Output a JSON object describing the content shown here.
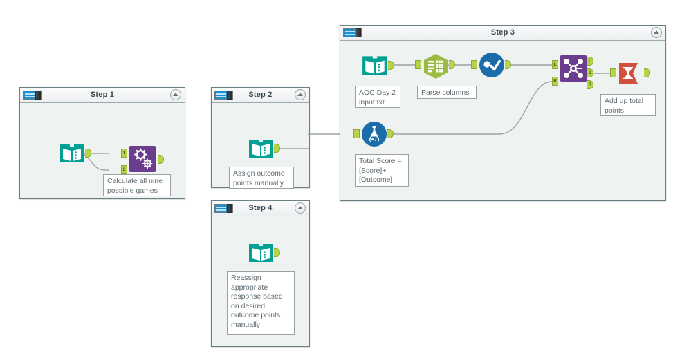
{
  "app": {
    "title": "Alteryx Designer workflow canvas",
    "canvas_background": "#ffffff",
    "container_fill": "#eef3f2",
    "container_border": "#6b7f86",
    "wire_color": "#9aa3a6",
    "anchor_color": "#b5d44a"
  },
  "containers": [
    {
      "id": "step1",
      "title": "Step 1",
      "toggle_icon": "container-toggle-icon",
      "collapse_icon": "chevron-up-icon"
    },
    {
      "id": "step2",
      "title": "Step 2",
      "toggle_icon": "container-toggle-icon",
      "collapse_icon": "chevron-up-icon"
    },
    {
      "id": "step3",
      "title": "Step 3",
      "toggle_icon": "container-toggle-icon",
      "collapse_icon": "chevron-up-icon"
    },
    {
      "id": "step4",
      "title": "Step 4",
      "toggle_icon": "container-toggle-icon",
      "collapse_icon": "chevron-up-icon"
    }
  ],
  "tools": {
    "step1_text_input": {
      "icon": "text-input-tool-icon",
      "color": "#00a094"
    },
    "step1_append_fields": {
      "icon": "append-fields-tool-icon",
      "color": "#6a3d8f",
      "input_t": "T",
      "input_s": "S"
    },
    "step2_text_input": {
      "icon": "text-input-tool-icon",
      "color": "#00a094"
    },
    "step3_input_data": {
      "icon": "input-data-tool-icon",
      "color": "#00a094"
    },
    "step3_text_to_columns": {
      "icon": "text-to-columns-tool-icon",
      "color": "#9bbb45"
    },
    "step3_select": {
      "icon": "select-tool-icon",
      "color": "#1b6ca8"
    },
    "step3_formula": {
      "icon": "formula-tool-icon",
      "color": "#1b6ca8"
    },
    "step3_join": {
      "icon": "join-tool-icon",
      "color": "#6a3d8f",
      "input_l": "L",
      "input_r": "R",
      "output_l": "L",
      "output_j": "J",
      "output_r": "R"
    },
    "step3_summarize": {
      "icon": "summarize-tool-icon",
      "color": "#d0503c"
    },
    "step4_text_input": {
      "icon": "text-input-tool-icon",
      "color": "#00a094"
    }
  },
  "annotations": {
    "step1_append": "Calculate all nine\npossible games",
    "step2_text_input": "Assign outcome\npoints manually",
    "step3_input_data": "AOC Day 2\ninput.txt",
    "step3_parse": "Parse columns",
    "step3_formula": "Total Score =\n[Score]+\n[Outcome]",
    "step3_summarize": "Add up total\npoints",
    "step4_text_input": "Reassign\nappropriate\nresponse based\non desired\noutcome points...\nmanually"
  }
}
